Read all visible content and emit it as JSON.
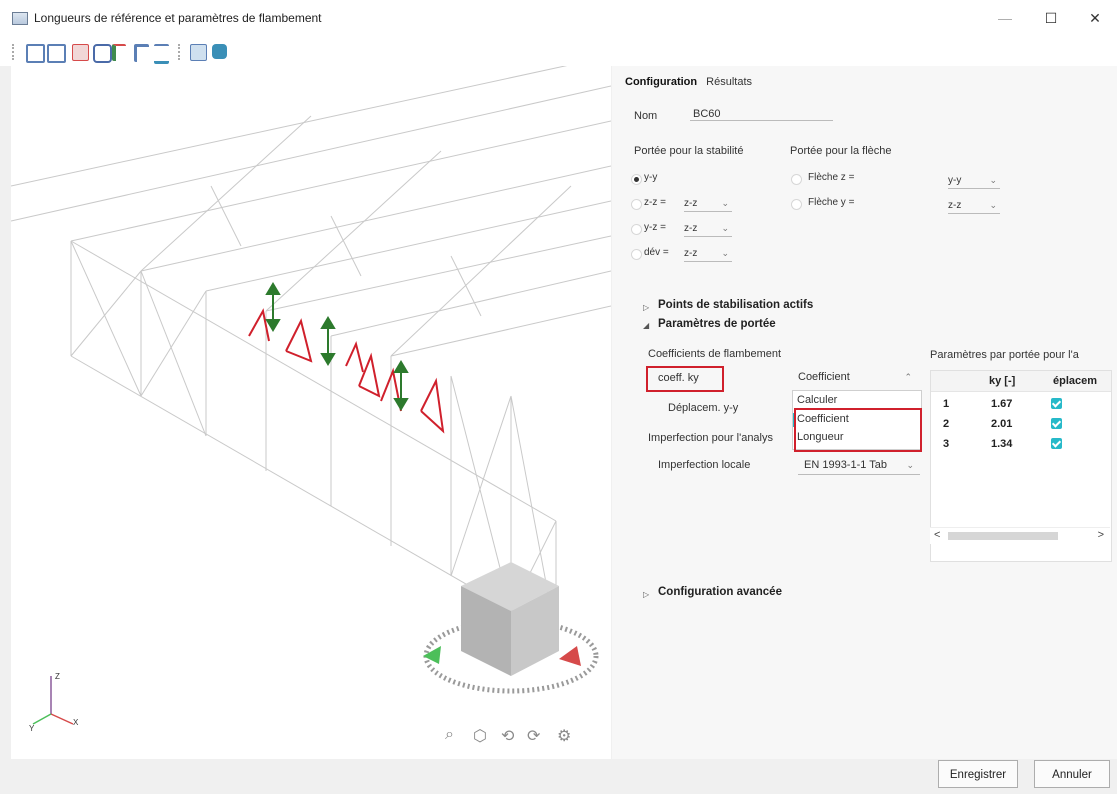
{
  "window": {
    "title": "Longueurs de référence et paramètres de flambement",
    "minimize": "—",
    "maximize": "☐",
    "close": "✕"
  },
  "toolbar": {
    "icons": [
      "frame-icon",
      "frame-icon-2",
      "member-red-icon",
      "layers-icon",
      "support-icon",
      "bracket-icon",
      "cable-icon",
      "table-icon",
      "render-icon"
    ],
    "icon_colors": [
      "#5b7fb5",
      "#5b7fb5",
      "#d64a4a",
      "#4a6aa8",
      "#3f8a4d",
      "#5b7fb5",
      "#3a8fb7",
      "#5b7fb5",
      "#3a8fb7"
    ]
  },
  "viewport": {
    "axis_z": "Z",
    "axis_y": "Y",
    "axis_x": "X"
  },
  "panel": {
    "tabs": [
      {
        "label": "Configuration",
        "active": true
      },
      {
        "label": "Résultats",
        "active": false
      }
    ],
    "nom_label": "Nom",
    "nom_value": "BC60",
    "stab_header": "Portée pour la stabilité",
    "fleche_header": "Portée pour la flèche",
    "stab_options": [
      {
        "label": "y-y",
        "selected": true,
        "value": ""
      },
      {
        "label": "z-z =",
        "selected": false,
        "value": "z-z"
      },
      {
        "label": "y-z =",
        "selected": false,
        "value": "z-z"
      },
      {
        "label": "dév =",
        "selected": false,
        "value": "z-z"
      }
    ],
    "fleche_options": [
      {
        "label": "Flèche z =",
        "value": "y-y"
      },
      {
        "label": "Flèche y =",
        "value": "z-z"
      }
    ],
    "section_points": "Points de stabilisation actifs",
    "section_params": "Paramètres de portée",
    "coeffs_label": "Coefficients de flambement",
    "coeff_ky_label": "coeff. ky",
    "coeff_select_value": "Coefficient",
    "deplacem_label": "Déplacem. y-y",
    "imperfection_label": "Imperfection pour l'analys",
    "imperf_locale_label": "Imperfection locale",
    "imperf_locale_value": "EN 1993-1-1 Tab",
    "dropdown_options": [
      "Calculer",
      "Coefficient",
      "Longueur"
    ],
    "section_advanced": "Configuration avancée"
  },
  "grid": {
    "title": "Paramètres par portée pour l'a",
    "headers": [
      "ky [-]",
      "éplacem"
    ],
    "rows": [
      {
        "index": "1",
        "ky": "1.67",
        "checked": true
      },
      {
        "index": "2",
        "ky": "2.01",
        "checked": true
      },
      {
        "index": "3",
        "ky": "1.34",
        "checked": true
      }
    ],
    "scroll_left": "<",
    "scroll_right": ">"
  },
  "footer": {
    "save_label": "Enregistrer",
    "cancel_label": "Annuler"
  },
  "colors": {
    "highlight_red": "#d0202c",
    "check_teal": "#27b9c9",
    "support_green": "#2d7a2d"
  }
}
